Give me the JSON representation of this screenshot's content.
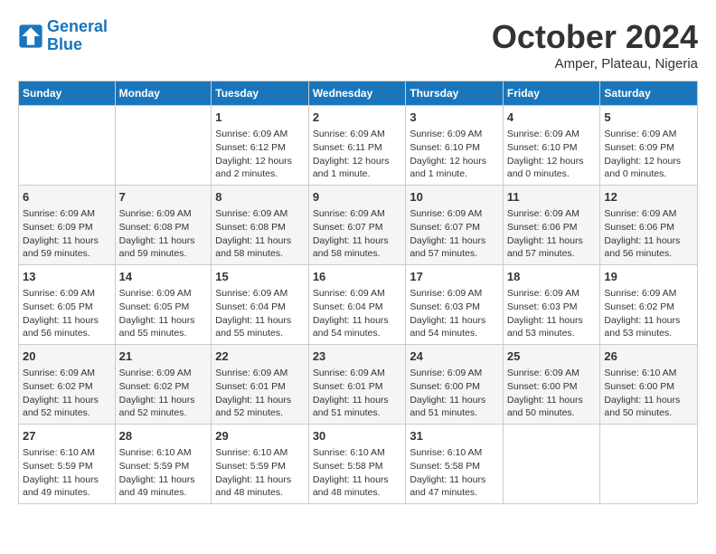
{
  "logo": {
    "general": "General",
    "blue": "Blue"
  },
  "title": "October 2024",
  "location": "Amper, Plateau, Nigeria",
  "days_of_week": [
    "Sunday",
    "Monday",
    "Tuesday",
    "Wednesday",
    "Thursday",
    "Friday",
    "Saturday"
  ],
  "weeks": [
    [
      {
        "day": "",
        "info": ""
      },
      {
        "day": "",
        "info": ""
      },
      {
        "day": "1",
        "info": "Sunrise: 6:09 AM\nSunset: 6:12 PM\nDaylight: 12 hours\nand 2 minutes."
      },
      {
        "day": "2",
        "info": "Sunrise: 6:09 AM\nSunset: 6:11 PM\nDaylight: 12 hours\nand 1 minute."
      },
      {
        "day": "3",
        "info": "Sunrise: 6:09 AM\nSunset: 6:10 PM\nDaylight: 12 hours\nand 1 minute."
      },
      {
        "day": "4",
        "info": "Sunrise: 6:09 AM\nSunset: 6:10 PM\nDaylight: 12 hours\nand 0 minutes."
      },
      {
        "day": "5",
        "info": "Sunrise: 6:09 AM\nSunset: 6:09 PM\nDaylight: 12 hours\nand 0 minutes."
      }
    ],
    [
      {
        "day": "6",
        "info": "Sunrise: 6:09 AM\nSunset: 6:09 PM\nDaylight: 11 hours\nand 59 minutes."
      },
      {
        "day": "7",
        "info": "Sunrise: 6:09 AM\nSunset: 6:08 PM\nDaylight: 11 hours\nand 59 minutes."
      },
      {
        "day": "8",
        "info": "Sunrise: 6:09 AM\nSunset: 6:08 PM\nDaylight: 11 hours\nand 58 minutes."
      },
      {
        "day": "9",
        "info": "Sunrise: 6:09 AM\nSunset: 6:07 PM\nDaylight: 11 hours\nand 58 minutes."
      },
      {
        "day": "10",
        "info": "Sunrise: 6:09 AM\nSunset: 6:07 PM\nDaylight: 11 hours\nand 57 minutes."
      },
      {
        "day": "11",
        "info": "Sunrise: 6:09 AM\nSunset: 6:06 PM\nDaylight: 11 hours\nand 57 minutes."
      },
      {
        "day": "12",
        "info": "Sunrise: 6:09 AM\nSunset: 6:06 PM\nDaylight: 11 hours\nand 56 minutes."
      }
    ],
    [
      {
        "day": "13",
        "info": "Sunrise: 6:09 AM\nSunset: 6:05 PM\nDaylight: 11 hours\nand 56 minutes."
      },
      {
        "day": "14",
        "info": "Sunrise: 6:09 AM\nSunset: 6:05 PM\nDaylight: 11 hours\nand 55 minutes."
      },
      {
        "day": "15",
        "info": "Sunrise: 6:09 AM\nSunset: 6:04 PM\nDaylight: 11 hours\nand 55 minutes."
      },
      {
        "day": "16",
        "info": "Sunrise: 6:09 AM\nSunset: 6:04 PM\nDaylight: 11 hours\nand 54 minutes."
      },
      {
        "day": "17",
        "info": "Sunrise: 6:09 AM\nSunset: 6:03 PM\nDaylight: 11 hours\nand 54 minutes."
      },
      {
        "day": "18",
        "info": "Sunrise: 6:09 AM\nSunset: 6:03 PM\nDaylight: 11 hours\nand 53 minutes."
      },
      {
        "day": "19",
        "info": "Sunrise: 6:09 AM\nSunset: 6:02 PM\nDaylight: 11 hours\nand 53 minutes."
      }
    ],
    [
      {
        "day": "20",
        "info": "Sunrise: 6:09 AM\nSunset: 6:02 PM\nDaylight: 11 hours\nand 52 minutes."
      },
      {
        "day": "21",
        "info": "Sunrise: 6:09 AM\nSunset: 6:02 PM\nDaylight: 11 hours\nand 52 minutes."
      },
      {
        "day": "22",
        "info": "Sunrise: 6:09 AM\nSunset: 6:01 PM\nDaylight: 11 hours\nand 52 minutes."
      },
      {
        "day": "23",
        "info": "Sunrise: 6:09 AM\nSunset: 6:01 PM\nDaylight: 11 hours\nand 51 minutes."
      },
      {
        "day": "24",
        "info": "Sunrise: 6:09 AM\nSunset: 6:00 PM\nDaylight: 11 hours\nand 51 minutes."
      },
      {
        "day": "25",
        "info": "Sunrise: 6:09 AM\nSunset: 6:00 PM\nDaylight: 11 hours\nand 50 minutes."
      },
      {
        "day": "26",
        "info": "Sunrise: 6:10 AM\nSunset: 6:00 PM\nDaylight: 11 hours\nand 50 minutes."
      }
    ],
    [
      {
        "day": "27",
        "info": "Sunrise: 6:10 AM\nSunset: 5:59 PM\nDaylight: 11 hours\nand 49 minutes."
      },
      {
        "day": "28",
        "info": "Sunrise: 6:10 AM\nSunset: 5:59 PM\nDaylight: 11 hours\nand 49 minutes."
      },
      {
        "day": "29",
        "info": "Sunrise: 6:10 AM\nSunset: 5:59 PM\nDaylight: 11 hours\nand 48 minutes."
      },
      {
        "day": "30",
        "info": "Sunrise: 6:10 AM\nSunset: 5:58 PM\nDaylight: 11 hours\nand 48 minutes."
      },
      {
        "day": "31",
        "info": "Sunrise: 6:10 AM\nSunset: 5:58 PM\nDaylight: 11 hours\nand 47 minutes."
      },
      {
        "day": "",
        "info": ""
      },
      {
        "day": "",
        "info": ""
      }
    ]
  ]
}
